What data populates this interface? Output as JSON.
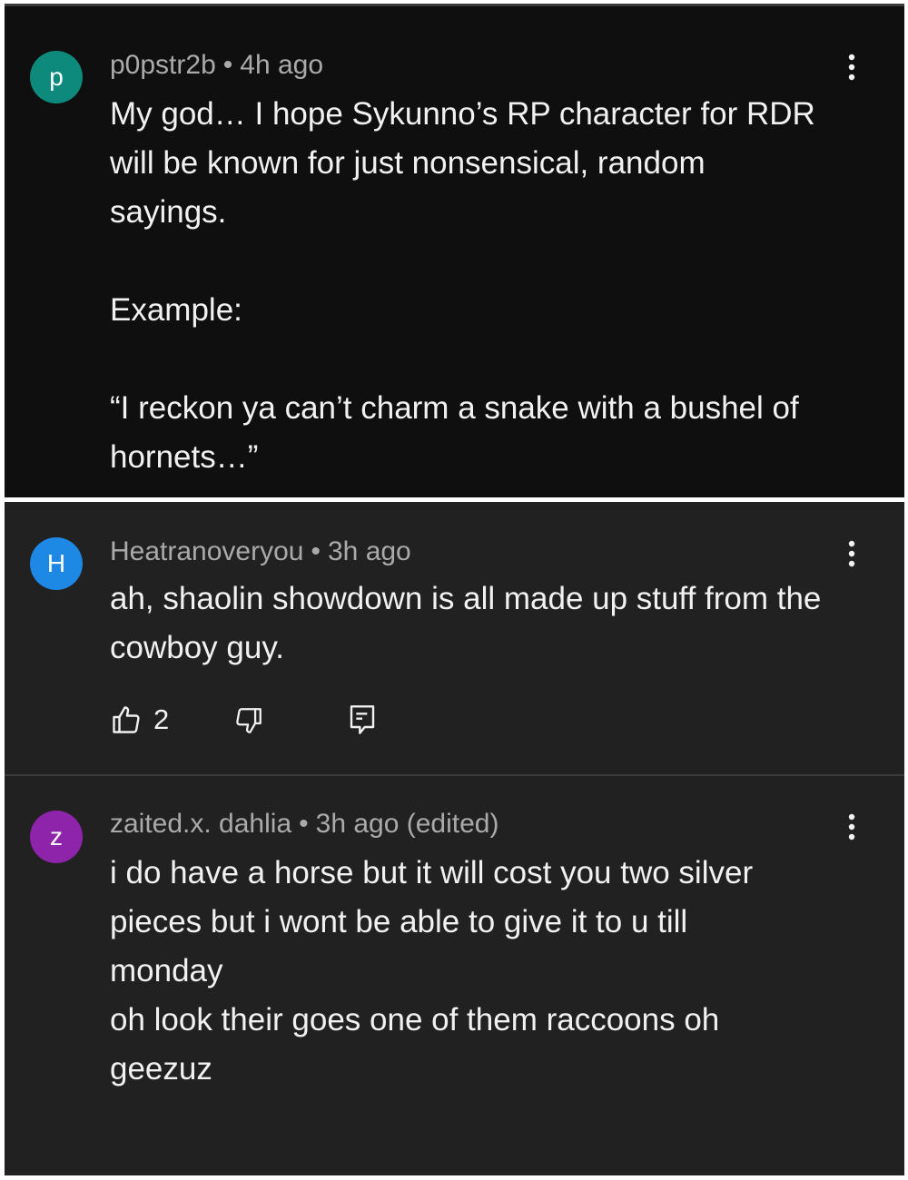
{
  "comments": [
    {
      "avatar_letter": "p",
      "avatar_color": "#0e8a7d",
      "username": "p0pstr2b",
      "separator": "•",
      "time": "4h ago",
      "paragraphs": [
        "My god… I hope Sykunno’s RP character for RDR will be known for just nonsensical, random sayings.",
        "Example:",
        "“I reckon ya can’t charm a snake with a bushel of hornets…”"
      ],
      "menu_icon": "more-vert-icon"
    },
    {
      "avatar_letter": "H",
      "avatar_color": "#1e88e5",
      "username": "Heatranoveryou",
      "separator": "•",
      "time": "3h ago",
      "paragraphs": [
        "ah, shaolin showdown is all made up stuff from the cowboy guy."
      ],
      "like_count": "2",
      "icons": [
        "thumbs-up-icon",
        "thumbs-down-icon",
        "reply-icon"
      ],
      "menu_icon": "more-vert-icon"
    },
    {
      "avatar_letter": "z",
      "avatar_color": "#8e24aa",
      "username": "zaited.x. dahlia",
      "separator": "•",
      "time": "3h ago (edited)",
      "lines": [
        "i do have a horse but it will cost you two silver pieces but i wont be able to give it to u till monday",
        "oh look their goes one of them raccoons oh geezuz"
      ],
      "menu_icon": "more-vert-icon"
    }
  ]
}
